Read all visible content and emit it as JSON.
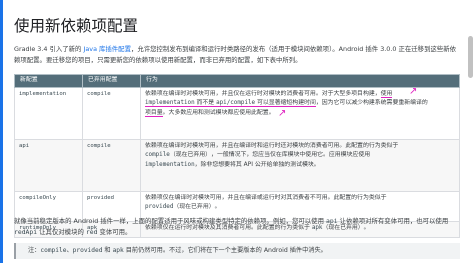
{
  "page": {
    "title": "使用新依赖项配置",
    "intro": {
      "t1": "Gradle 3.4 引入了新的 ",
      "link1": "Java 库插件配置",
      "t2": "，允许您控制发布到编译和运行时类路径的发布（适用于模块间依赖项）。Android 插件 3.0.0 正在迁移到这些新依赖项配置。要迁移您的项目，只需更新您的依赖项以使用新配置，而非已弃用的配置，如下表中所列。"
    },
    "table": {
      "headers": [
        "新配置",
        "已弃用配置",
        "行为"
      ],
      "rows": [
        {
          "new": "implementation",
          "old": "compile",
          "b1": "依赖项在编译时对模块可用，并且仅在运行时对模块的消费者可用。对于大型多项目构建，",
          "b1m": "使用",
          "b2m1": "implementation",
          "b2m2": " 而不是 ",
          "b2m3": "api/compile",
          "b2m4": " 可以显著缩短构建时间",
          "b2": "，因为它可以减少构建系统需要重新编译的",
          "b3m": "项目量",
          "b3": "。大多数应用和测试模块都应使用此配置。"
        },
        {
          "new": "api",
          "old": "compile",
          "b1": "依赖项在编译时对模块可用，并且在编译时和运行时还对模块的消费者可用。此配置的行为类似于",
          "b2a": "compile",
          "b2b": "（现在已弃用），一般情况下，您应当仅在库模块中使用它。应用模块应使用",
          "b3a": "implementation",
          "b3b": "，除非您想要将其 API 公开给单独的测试模块。"
        },
        {
          "new": "compileOnly",
          "old": "provided",
          "b1": "依赖项仅在编译时对模块可用，并且在编译或运行时对其消费者不可用。此配置的行为类似于",
          "b2a": "provided",
          "b2b": "（现在已弃用）。"
        },
        {
          "new": "runtimeOnly",
          "old": "apk",
          "b1a": "依赖项仅在运行时对模块及其消费者可用。此配置的行为类似于 ",
          "b1b": "apk",
          "b1c": "（现在已弃用）。"
        }
      ]
    },
    "after": {
      "t1": "就像当前稳定版本的 Android 插件一样，上面的配置适用于风味或构建类型特定的依赖项。例如，您可以使用 ",
      "c1": "api",
      "t2": " 让依赖项对所有变体可用，也可以使用 ",
      "c2": "redApi",
      "t3": " 让其仅对模块的 ",
      "c3": "red",
      "t4": " 变体可用。"
    },
    "note": {
      "t1": "注：",
      "c1": "compile",
      "t2": "、",
      "c2": "provided",
      "t3": " 和 ",
      "c3": "apk",
      "t4": " 目前仍然可用。不过，它们将在下一个主要版本的 Android 插件中消失。"
    }
  },
  "colors": {
    "accent": "#1a73e8",
    "table_header": "#546e7a",
    "highlight": "#e020c0"
  }
}
